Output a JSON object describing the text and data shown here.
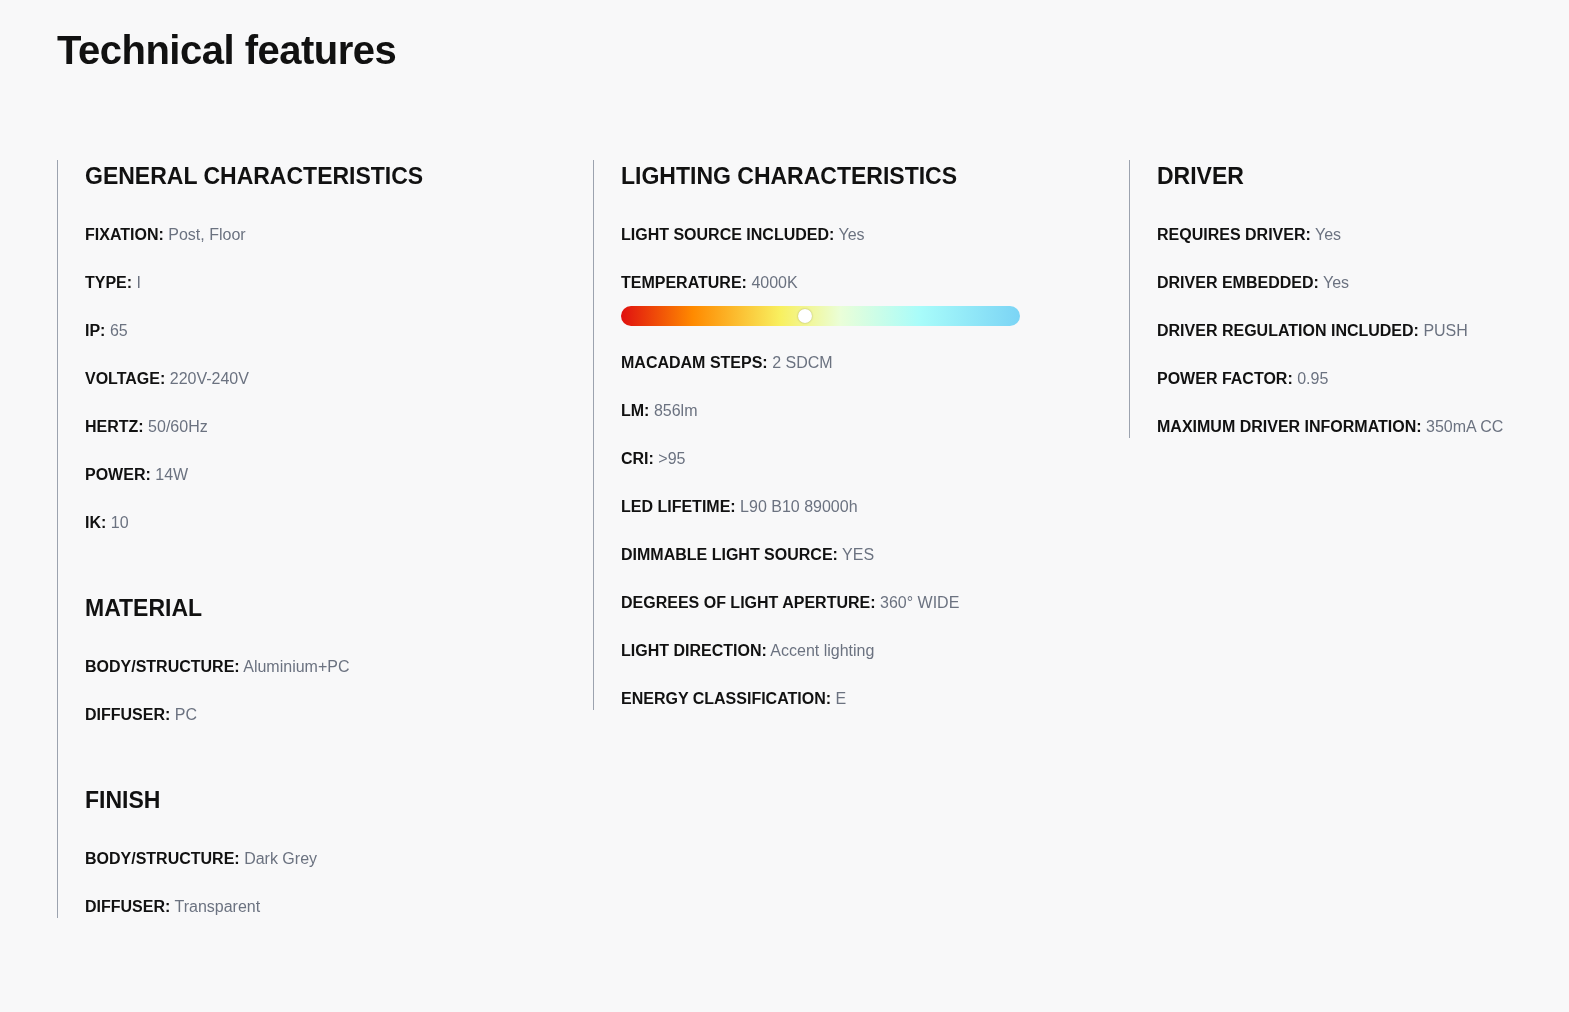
{
  "title": "Technical features",
  "columns": [
    {
      "sections": [
        {
          "title": "GENERAL CHARACTERISTICS",
          "rows": [
            {
              "kind": "text",
              "label": "FIXATION:",
              "value": "Post, Floor"
            },
            {
              "kind": "text",
              "label": "TYPE:",
              "value": "I"
            },
            {
              "kind": "text",
              "label": "IP:",
              "value": "65"
            },
            {
              "kind": "text",
              "label": "VOLTAGE:",
              "value": "220V-240V"
            },
            {
              "kind": "text",
              "label": "HERTZ:",
              "value": "50/60Hz"
            },
            {
              "kind": "text",
              "label": "POWER:",
              "value": "14W"
            },
            {
              "kind": "text",
              "label": "IK:",
              "value": "10"
            }
          ]
        },
        {
          "title": "MATERIAL",
          "rows": [
            {
              "kind": "text",
              "label": "BODY/STRUCTURE:",
              "value": "Aluminium+PC"
            },
            {
              "kind": "text",
              "label": "DIFFUSER:",
              "value": "PC"
            }
          ]
        },
        {
          "title": "FINISH",
          "rows": [
            {
              "kind": "text",
              "label": "BODY/STRUCTURE:",
              "value": "Dark Grey"
            },
            {
              "kind": "text",
              "label": "DIFFUSER:",
              "value": "Transparent"
            }
          ]
        }
      ]
    },
    {
      "sections": [
        {
          "title": "LIGHTING CHARACTERISTICS",
          "rows": [
            {
              "kind": "text",
              "label": "LIGHT SOURCE INCLUDED:",
              "value": "Yes"
            },
            {
              "kind": "slider",
              "label": "TEMPERATURE:",
              "value": "4000K",
              "level": 0.46
            },
            {
              "kind": "text",
              "label": "MACADAM STEPS:",
              "value": "2 SDCM"
            },
            {
              "kind": "text",
              "label": "LM:",
              "value": "856lm"
            },
            {
              "kind": "text",
              "label": "CRI:",
              "value": ">95"
            },
            {
              "kind": "text",
              "label": "LED LIFETIME:",
              "value": "L90 B10 89000h"
            },
            {
              "kind": "text",
              "label": "DIMMABLE LIGHT SOURCE:",
              "value": "YES"
            },
            {
              "kind": "text",
              "label": "DEGREES OF LIGHT APERTURE:",
              "value": "360° WIDE"
            },
            {
              "kind": "text",
              "label": "LIGHT DIRECTION:",
              "value": "Accent lighting"
            },
            {
              "kind": "text",
              "label": "ENERGY CLASSIFICATION:",
              "value": "E"
            }
          ]
        }
      ]
    },
    {
      "sections": [
        {
          "title": "DRIVER",
          "rows": [
            {
              "kind": "text",
              "label": "REQUIRES DRIVER:",
              "value": "Yes"
            },
            {
              "kind": "text",
              "label": "DRIVER EMBEDDED:",
              "value": "Yes"
            },
            {
              "kind": "text",
              "label": "DRIVER REGULATION INCLUDED:",
              "value": "PUSH"
            },
            {
              "kind": "text",
              "label": "POWER FACTOR:",
              "value": "0.95"
            },
            {
              "kind": "text",
              "label": "MAXIMUM DRIVER INFORMATION:",
              "value": "350mA CC"
            }
          ]
        }
      ]
    }
  ]
}
